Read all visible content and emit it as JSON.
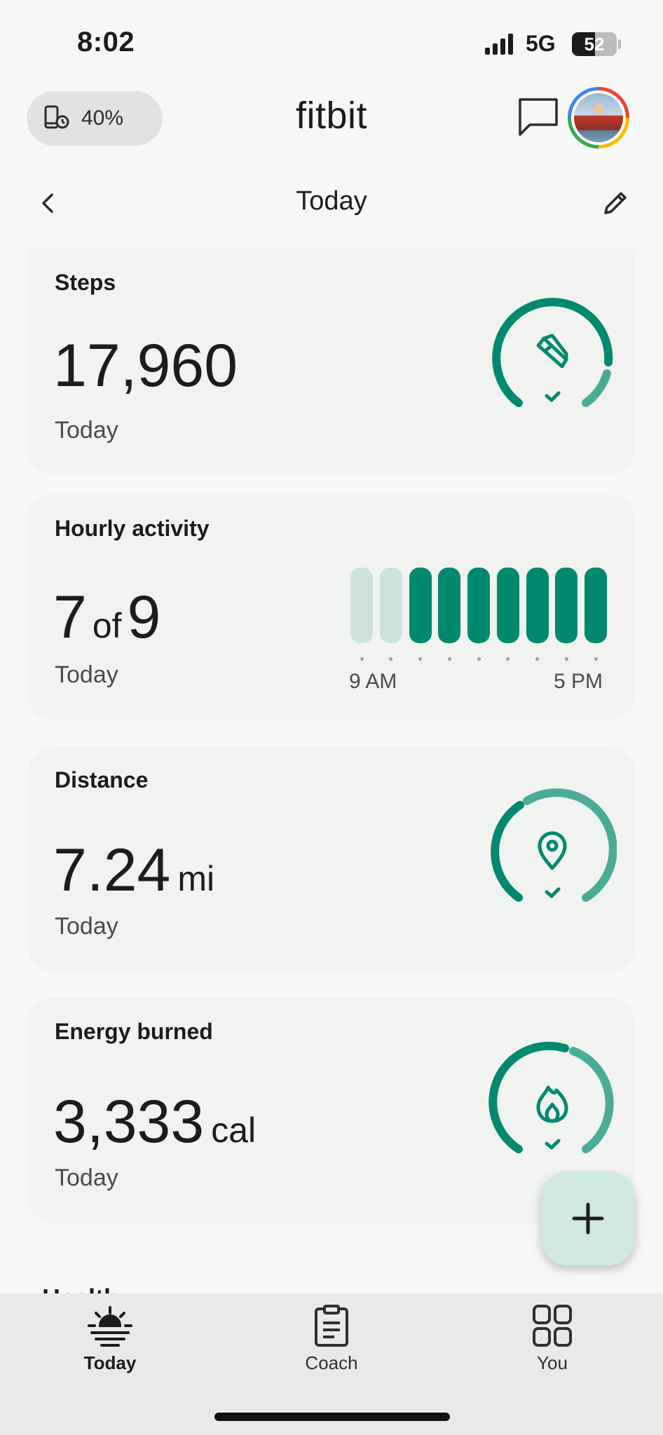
{
  "status_bar": {
    "time": "8:02",
    "network": "5G",
    "battery": "52",
    "battery_level": 0.52
  },
  "header": {
    "device_battery": "40%",
    "app_title": "fitbit"
  },
  "subheader": {
    "title": "Today"
  },
  "cards": {
    "steps": {
      "title": "Steps",
      "value": "17,960",
      "sub": "Today",
      "icon": "shoe-icon"
    },
    "hourly": {
      "title": "Hourly activity",
      "value_done": "7",
      "of": "of",
      "value_total": "9",
      "sub": "Today",
      "bars": [
        false,
        false,
        true,
        true,
        true,
        true,
        true,
        true,
        true
      ],
      "start_label": "9 AM",
      "end_label": "5 PM"
    },
    "distance": {
      "title": "Distance",
      "value": "7.24",
      "unit": "mi",
      "sub": "Today",
      "icon": "location-pin-icon"
    },
    "energy": {
      "title": "Energy burned",
      "value": "3,333",
      "unit": "cal",
      "sub": "Today",
      "icon": "flame-icon"
    }
  },
  "next_section_peek": "Health",
  "fab": {
    "icon": "plus-icon"
  },
  "nav": [
    {
      "label": "Today",
      "icon": "sunrise-icon",
      "active": true
    },
    {
      "label": "Coach",
      "icon": "clipboard-icon",
      "active": false
    },
    {
      "label": "You",
      "icon": "grid-icon",
      "active": false
    }
  ],
  "colors": {
    "accent": "#00896f",
    "accent_light": "#4aab99",
    "bar_inactive": "#cde3de",
    "card": "#f1f3f1"
  }
}
